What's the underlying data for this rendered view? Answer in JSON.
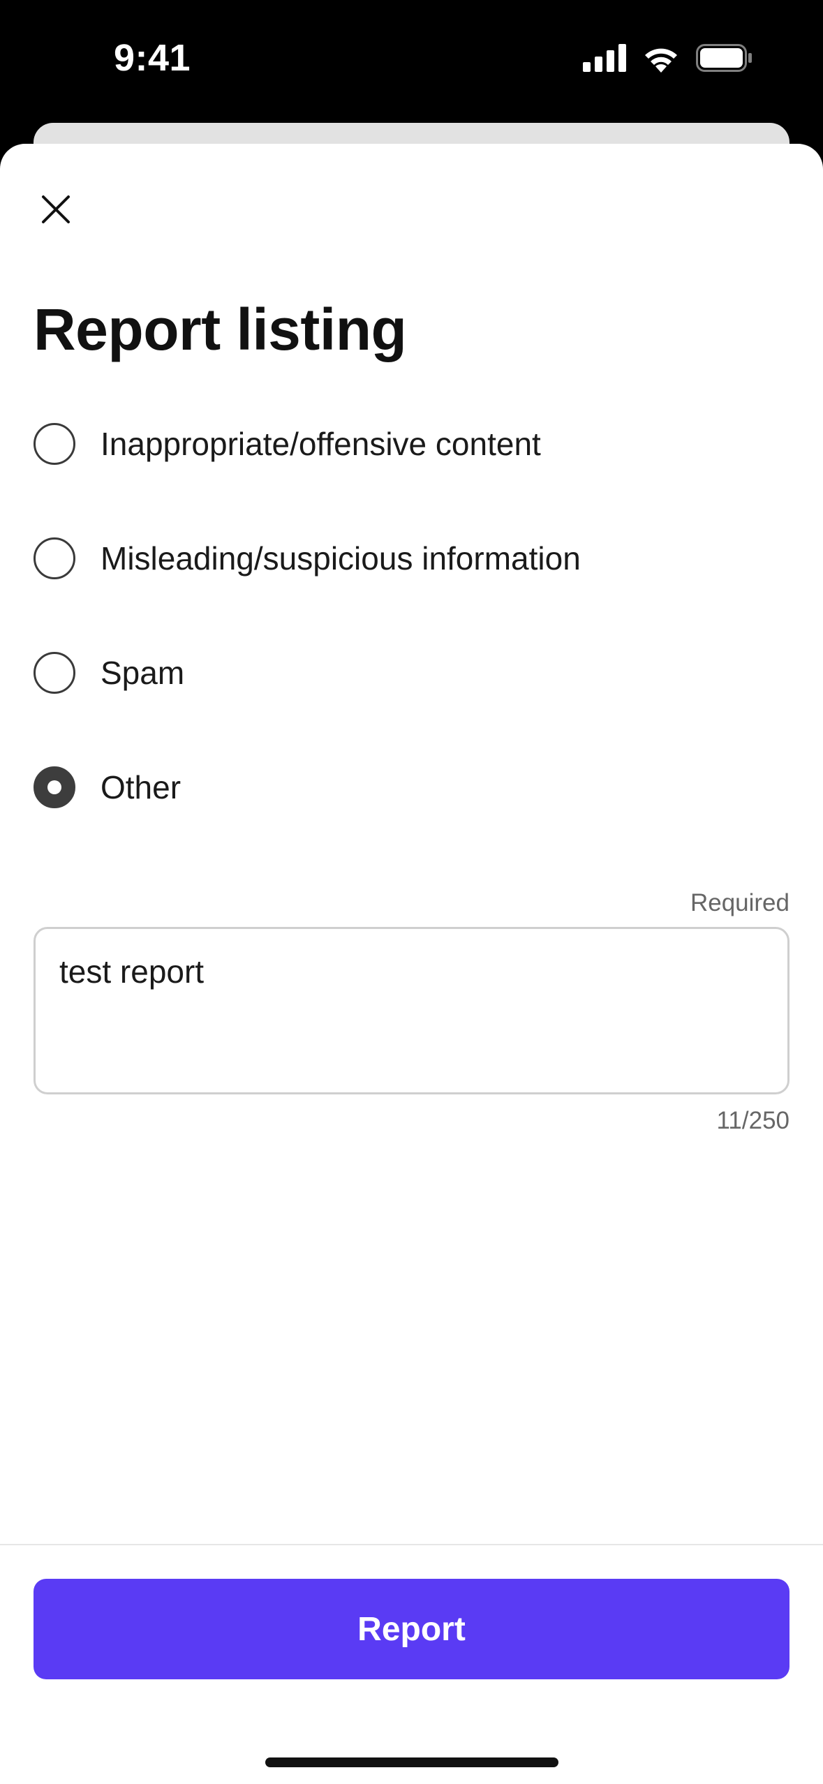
{
  "status_bar": {
    "time": "9:41",
    "icons": [
      "cellular-signal-icon",
      "wifi-icon",
      "battery-icon"
    ]
  },
  "sheet": {
    "close_icon": "close-icon",
    "title": "Report listing",
    "options": [
      {
        "label": "Inappropriate/offensive content",
        "selected": false
      },
      {
        "label": "Misleading/suspicious information",
        "selected": false
      },
      {
        "label": "Spam",
        "selected": false
      },
      {
        "label": "Other",
        "selected": true
      }
    ],
    "details": {
      "required_label": "Required",
      "value": "test report",
      "counter": "11/250"
    },
    "report_button": "Report"
  },
  "colors": {
    "accent": "#5a3bf4",
    "radio_selected": "#3d3d3d"
  }
}
